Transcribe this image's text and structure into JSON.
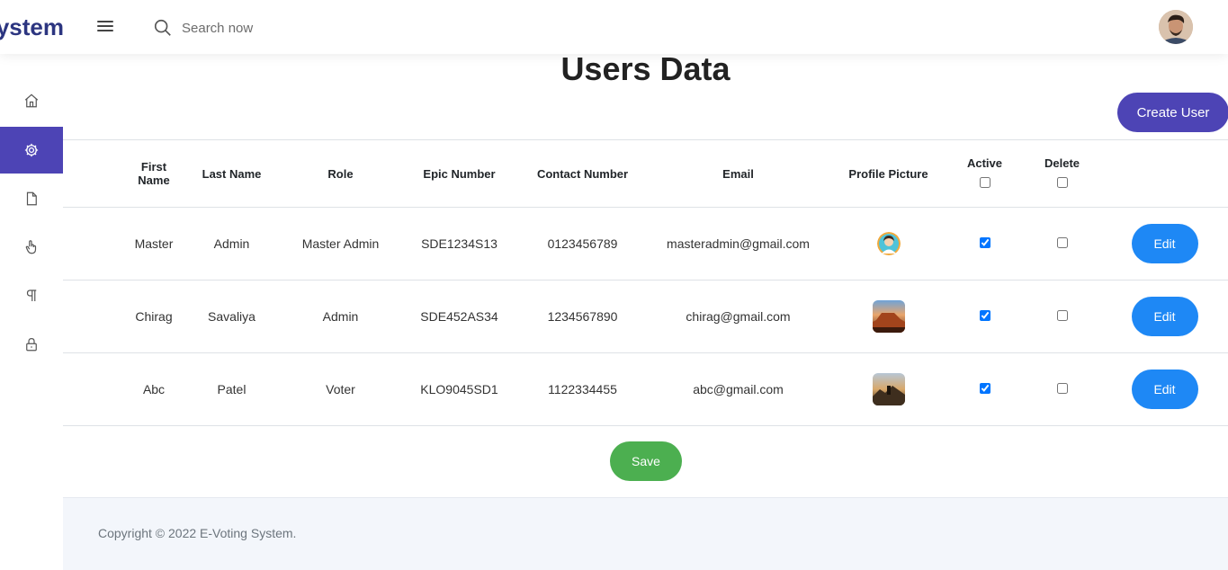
{
  "header": {
    "brand": "E-Voting System",
    "search_placeholder": "Search now"
  },
  "sidebar": {
    "items": [
      {
        "icon": "home-icon"
      },
      {
        "icon": "gear-icon",
        "active": true
      },
      {
        "icon": "file-icon"
      },
      {
        "icon": "hand-icon"
      },
      {
        "icon": "paragraph-icon"
      },
      {
        "icon": "lock-icon"
      }
    ]
  },
  "main": {
    "title": "Users Data",
    "create_label": "Create User",
    "columns": [
      "First Name",
      "Last Name",
      "Role",
      "Epic Number",
      "Contact Number",
      "Email",
      "Profile Picture",
      "Active",
      "Delete"
    ],
    "rows": [
      {
        "first": "Master",
        "last": "Admin",
        "role": "Master Admin",
        "epic": "SDE1234S13",
        "contact": "0123456789",
        "email": "masteradmin@gmail.com",
        "active": true,
        "delete": false,
        "edit": "Edit"
      },
      {
        "first": "Chirag",
        "last": "Savaliya",
        "role": "Admin",
        "epic": "SDE452AS34",
        "contact": "1234567890",
        "email": "chirag@gmail.com",
        "active": true,
        "delete": false,
        "edit": "Edit"
      },
      {
        "first": "Abc",
        "last": "Patel",
        "role": "Voter",
        "epic": "KLO9045SD1",
        "contact": "1122334455",
        "email": "abc@gmail.com",
        "active": true,
        "delete": false,
        "edit": "Edit"
      }
    ],
    "save_label": "Save"
  },
  "footer": {
    "copyright": "Copyright © 2022 E-Voting System."
  },
  "colors": {
    "primary": "#4d44b5",
    "edit": "#1e88f5",
    "save": "#4caf50"
  }
}
